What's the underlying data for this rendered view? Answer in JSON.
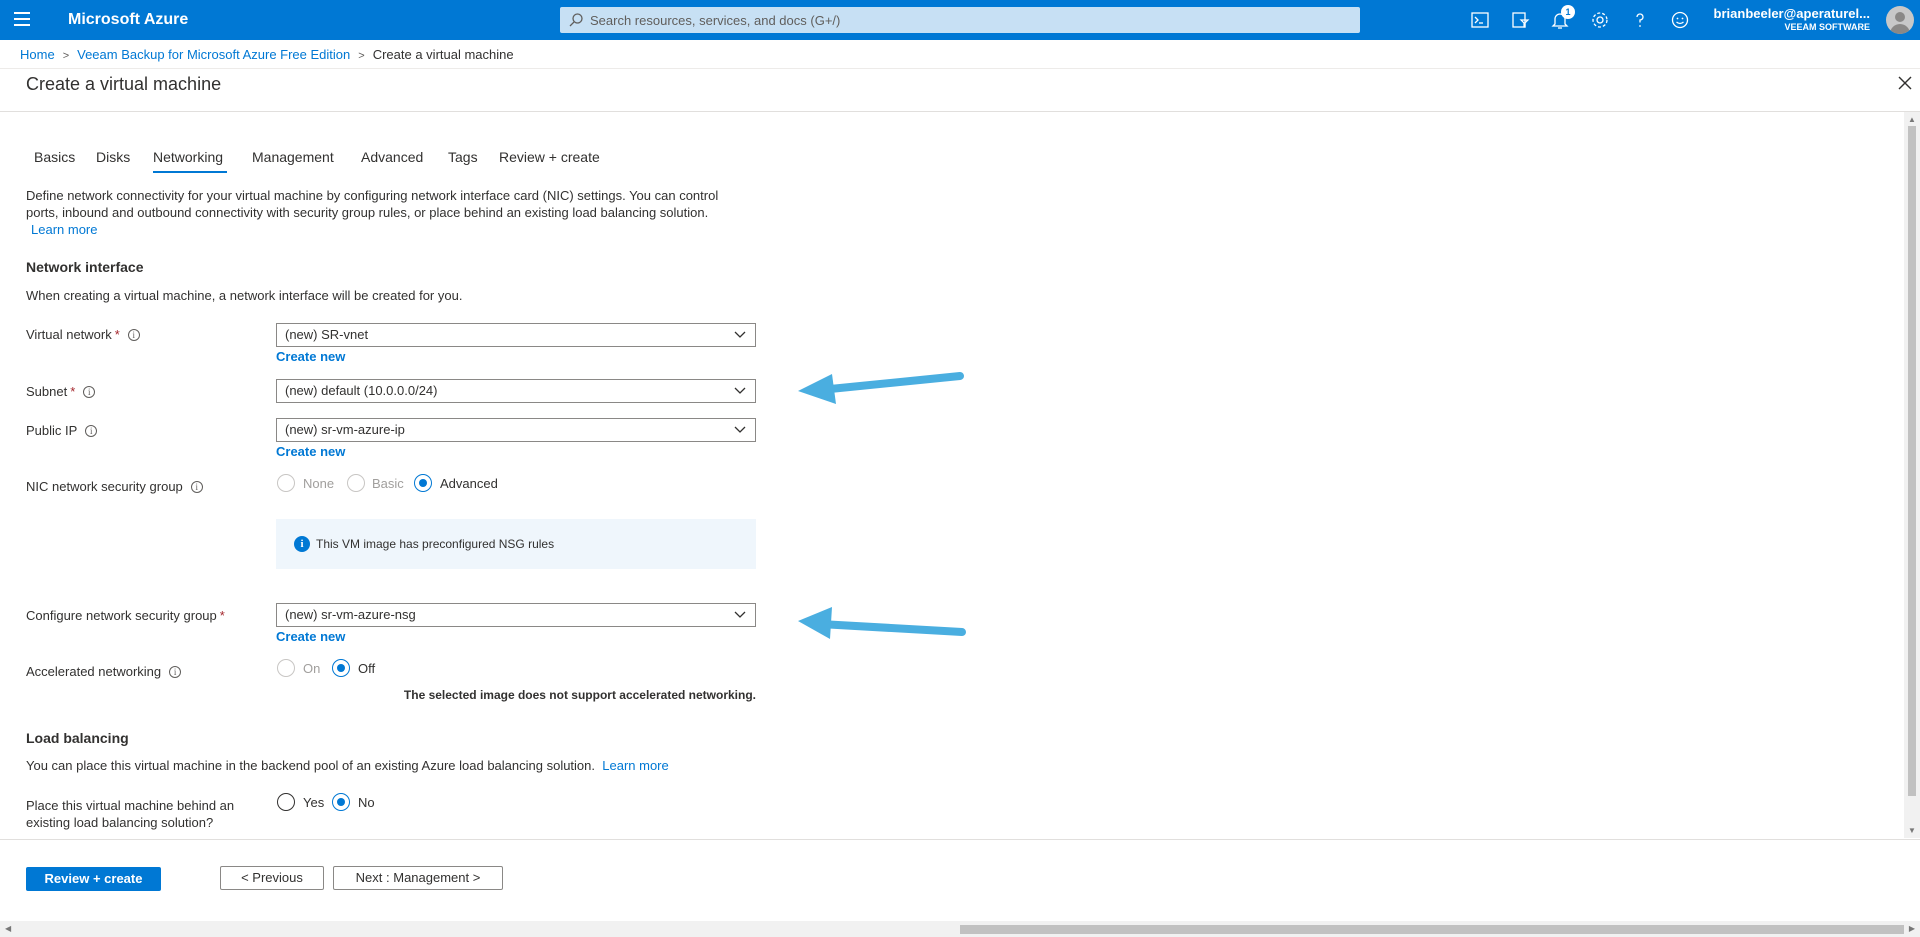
{
  "topbar": {
    "brand": "Microsoft Azure",
    "search_placeholder": "Search resources, services, and docs (G+/)",
    "notification_count": "1",
    "user_name": "brianbeeler@aperaturel...",
    "user_org": "VEEAM SOFTWARE",
    "icons": [
      "cloud-shell-icon",
      "directory-filter-icon",
      "notifications-icon",
      "settings-icon",
      "help-icon",
      "feedback-icon"
    ]
  },
  "breadcrumb": {
    "home": "Home",
    "parent": "Veeam Backup for Microsoft Azure Free Edition",
    "current": "Create a virtual machine"
  },
  "page_title": "Create a virtual machine",
  "tabs": [
    {
      "label": "Basics"
    },
    {
      "label": "Disks"
    },
    {
      "label": "Networking"
    },
    {
      "label": "Management"
    },
    {
      "label": "Advanced"
    },
    {
      "label": "Tags"
    },
    {
      "label": "Review + create"
    }
  ],
  "intro": {
    "line1": "Define network connectivity for your virtual machine by configuring network interface card (NIC) settings. You can control",
    "line2": "ports, inbound and outbound connectivity with security group rules, or place behind an existing load balancing solution.",
    "learn_more": "Learn more"
  },
  "network_interface": {
    "heading": "Network interface",
    "description": "When creating a virtual machine, a network interface will be created for you.",
    "virtual_network_label": "Virtual network",
    "virtual_network_value": "(new) SR-vnet",
    "subnet_label": "Subnet",
    "subnet_value": "(new) default (10.0.0.0/24)",
    "public_ip_label": "Public IP",
    "public_ip_value": "(new) sr-vm-azure-ip",
    "nic_nsg_label": "NIC network security group",
    "nic_nsg_options": [
      "None",
      "Basic",
      "Advanced"
    ],
    "nic_nsg_selected": "Advanced",
    "info_text": "This VM image has preconfigured NSG rules",
    "configure_nsg_label": "Configure network security group",
    "configure_nsg_value": "(new) sr-vm-azure-nsg",
    "create_new": "Create new",
    "accel_label": "Accelerated networking",
    "accel_options": [
      "On",
      "Off"
    ],
    "accel_selected": "Off",
    "accel_note": "The selected image does not support accelerated networking.",
    "required_mark": "*"
  },
  "load_balancing": {
    "heading": "Load balancing",
    "description": "You can place this virtual machine in the backend pool of an existing Azure load balancing solution.",
    "learn_more": "Learn more",
    "question_line1": "Place this virtual machine behind an",
    "question_line2": "existing load balancing solution?",
    "options": [
      "Yes",
      "No"
    ],
    "selected": "No"
  },
  "footer": {
    "review_create": "Review + create",
    "previous": "< Previous",
    "next": "Next : Management >"
  },
  "colors": {
    "azure_blue": "#0078d4",
    "annotation_arrow": "#4aaee0"
  }
}
